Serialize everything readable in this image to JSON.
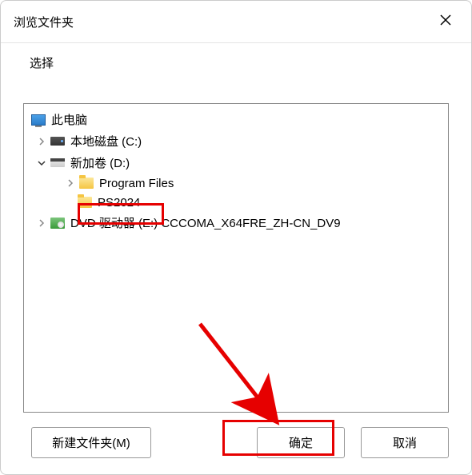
{
  "window": {
    "title": "浏览文件夹",
    "prompt": "选择"
  },
  "tree": {
    "root": {
      "label": "此电脑"
    },
    "items": [
      {
        "label": "本地磁盘 (C:)",
        "expanded": false,
        "type": "disk"
      },
      {
        "label": "新加卷 (D:)",
        "expanded": true,
        "type": "disk2",
        "children": [
          {
            "label": "Program Files",
            "expanded": false,
            "type": "folder"
          },
          {
            "label": "PS2024",
            "expanded": null,
            "type": "folder",
            "highlighted": true
          }
        ]
      },
      {
        "label": "DVD 驱动器 (E:) CCCOMA_X64FRE_ZH-CN_DV9",
        "expanded": false,
        "type": "dvd"
      }
    ]
  },
  "buttons": {
    "new_folder": "新建文件夹(M)",
    "ok": "确定",
    "cancel": "取消"
  },
  "annotations": {
    "highlight_color": "#e60000"
  }
}
